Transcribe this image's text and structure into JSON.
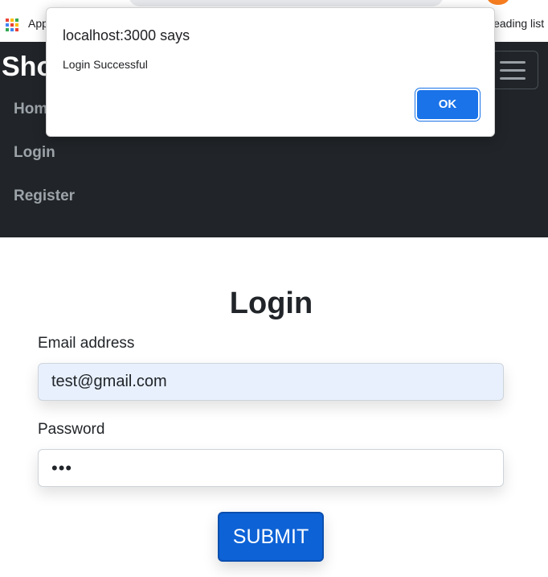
{
  "browser": {
    "bookmarks": {
      "apps_label": "Apps",
      "reading_list_label": "Reading list"
    },
    "apps_icon_colors": [
      "#ea4335",
      "#fbbc04",
      "#34a853",
      "#4285f4",
      "#ea4335",
      "#fbbc04",
      "#34a853",
      "#4285f4",
      "#ea4335"
    ]
  },
  "navbar": {
    "brand": "Shop",
    "links": [
      "Home",
      "Login",
      "Register"
    ],
    "background": "#212529"
  },
  "dialog": {
    "title": "localhost:3000 says",
    "message": "Login Successful",
    "ok_label": "OK",
    "ok_color": "#1a73e8"
  },
  "login": {
    "title": "Login",
    "email_label": "Email address",
    "email_value": "test@gmail.com",
    "password_label": "Password",
    "password_value": "•••",
    "submit_label": "SUBMIT",
    "submit_color": "#0d62d6"
  }
}
